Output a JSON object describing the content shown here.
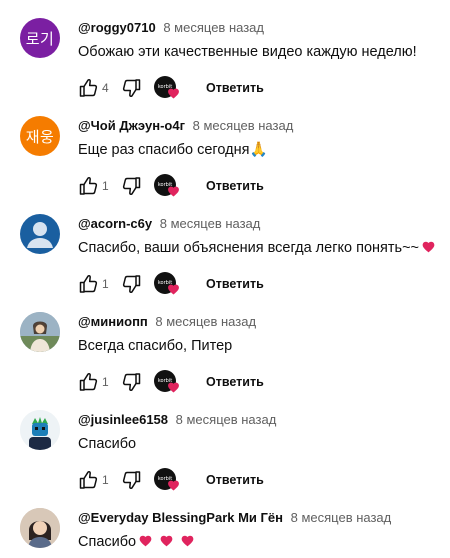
{
  "reply_label": "Ответить",
  "creator_badge_text": "korbit",
  "colors": {
    "heart_red": "#e0245e",
    "avatar_purple": "#7b1fa2",
    "avatar_orange": "#f57c00",
    "avatar_blue": "#1a5fa0",
    "author_text": "#0f0f0f",
    "meta_text": "#606060"
  },
  "comments": [
    {
      "author": "@roggy0710",
      "time": "8 месяцев назад",
      "text": "Обожаю эти качественные видео каждую неделю!",
      "likes": "4",
      "avatar_text": "로기",
      "avatar_color": "#7b1fa2"
    },
    {
      "author": "@Чой Джэун-о4г",
      "time": "8 месяцев назад",
      "text": "Еще раз спасибо сегодня",
      "text_emoji": "🙏",
      "likes": "1",
      "avatar_text": "재웅",
      "avatar_color": "#f57c00"
    },
    {
      "author": "@acorn-c6y",
      "time": "8 месяцев назад",
      "text": "Спасибо, ваши объяснения всегда легко понять~~",
      "text_emoji": "heart-emoji",
      "likes": "1",
      "avatar_icon": "default-person-icon",
      "avatar_color": "#1a5fa0"
    },
    {
      "author": "@миниопп",
      "time": "8 месяцев назад",
      "text": "Всегда спасибо, Питер",
      "likes": "1",
      "avatar_icon": "photo-avatar"
    },
    {
      "author": "@jusinlee6158",
      "time": "8 месяцев назад",
      "text": "Спасибо",
      "likes": "1",
      "avatar_icon": "character-avatar"
    },
    {
      "author": "@Everyday BlessingPark Ми Гён",
      "time": "8 месяцев назад",
      "text": "Спасибо",
      "text_emoji": "heart-emoji x3",
      "avatar_icon": "photo-avatar"
    }
  ]
}
